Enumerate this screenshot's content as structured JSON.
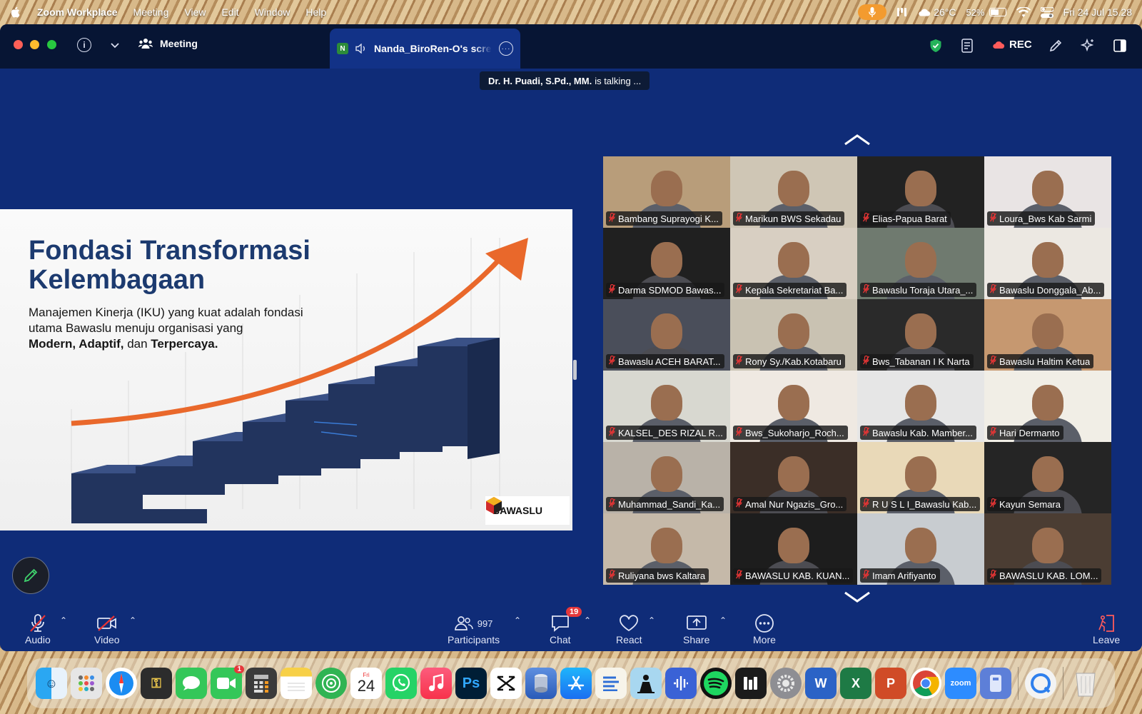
{
  "menubar": {
    "app": "Zoom Workplace",
    "menus": [
      "Meeting",
      "View",
      "Edit",
      "Window",
      "Help"
    ],
    "temperature": "26°C",
    "battery": "52%",
    "datetime": "Fri 24 Jul  15.28"
  },
  "titlebar": {
    "meeting_label": "Meeting",
    "share_tab_initial": "N",
    "share_tab_title": "Nanda_BiroRen-O's screen",
    "rec_label": "REC"
  },
  "talking": {
    "speaker": "Dr. H. Puadi, S.Pd., MM.",
    "suffix": "is talking ..."
  },
  "slide": {
    "title_line1": "Fondasi Transformasi",
    "title_line2": "Kelembagaan",
    "sub_line1": "Manajemen Kinerja (IKU) yang kuat adalah fondasi",
    "sub_line2": "utama Bawaslu menuju organisasi yang",
    "sub_bold1": "Modern, Adaptif,",
    "sub_and": " dan ",
    "sub_bold2": "Terpercaya.",
    "logo_text": "BAWASLU"
  },
  "participants_grid": [
    {
      "name": "Bambang Suprayogi K...",
      "bg": "#b89d7a"
    },
    {
      "name": "Marikun BWS Sekadau",
      "bg": "#cfc6b5"
    },
    {
      "name": "Elias-Papua Barat",
      "bg": "#222222"
    },
    {
      "name": "Loura_Bws Kab Sarmi",
      "bg": "#e9e4e4"
    },
    {
      "name": "Darma SDMOD Bawas...",
      "bg": "#202020"
    },
    {
      "name": "Kepala Sekretariat Ba...",
      "bg": "#d8cfc2"
    },
    {
      "name": "Bawaslu Toraja Utara_...",
      "bg": "#6f7a6f"
    },
    {
      "name": "Bawaslu Donggala_Ab...",
      "bg": "#ece8e2"
    },
    {
      "name": "Bawaslu ACEH BARAT...",
      "bg": "#4a4e5a"
    },
    {
      "name": "Rony Sy./Kab.Kotabaru",
      "bg": "#c9c2b2"
    },
    {
      "name": "Bws_Tabanan I K Narta",
      "bg": "#2a2a2a"
    },
    {
      "name": "Bawaslu Haltim Ketua",
      "bg": "#c69870"
    },
    {
      "name": "KALSEL_DES RIZAL R...",
      "bg": "#d8d8d0"
    },
    {
      "name": "Bws_Sukoharjo_Roch...",
      "bg": "#efe9e2"
    },
    {
      "name": "Bawaslu Kab. Mamber...",
      "bg": "#e6e6e6"
    },
    {
      "name": "Hari Dermanto",
      "bg": "#f1eee6"
    },
    {
      "name": "Muhammad_Sandi_Ka...",
      "bg": "#b9b2a8"
    },
    {
      "name": "Amal Nur Ngazis_Gro...",
      "bg": "#3b2e27"
    },
    {
      "name": "R U S L I_Bawaslu Kab...",
      "bg": "#e9d9b8"
    },
    {
      "name": "Kayun Semara",
      "bg": "#252525"
    },
    {
      "name": "Ruliyana bws Kaltara",
      "bg": "#c5b9a9"
    },
    {
      "name": "BAWASLU KAB. KUAN...",
      "bg": "#1d1d1d"
    },
    {
      "name": "Imam Arifiyanto",
      "bg": "#c8ccd0"
    },
    {
      "name": "BAWASLU KAB.  LOM...",
      "bg": "#4b3d33"
    }
  ],
  "toolbar": {
    "audio": "Audio",
    "video": "Video",
    "participants": "Participants",
    "participants_count": "997",
    "chat": "Chat",
    "chat_badge": "19",
    "react": "React",
    "share": "Share",
    "more": "More",
    "leave": "Leave"
  },
  "dock": {
    "calendar_month": "Fri",
    "calendar_day": "24",
    "facetime_badge": "1",
    "zoom_label": "zoom",
    "ps_label": "Ps"
  }
}
